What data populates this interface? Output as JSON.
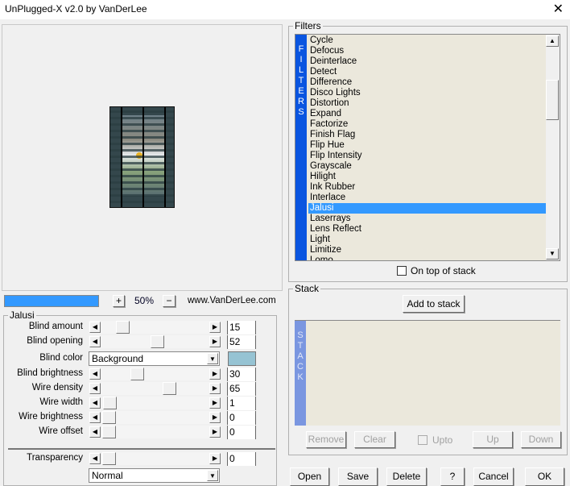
{
  "window": {
    "title": "UnPlugged-X v2.0 by VanDerLee",
    "close_icon": "close-icon"
  },
  "preview": {
    "zoom_progress_percent": 100,
    "zoom_in_label": "+",
    "zoom_level": "50%",
    "zoom_out_label": "−",
    "website": "www.VanDerLee.com"
  },
  "jalusi": {
    "title": "Jalusi",
    "sliders": [
      {
        "label": "Blind amount",
        "value": "15"
      },
      {
        "label": "Blind opening",
        "value": "52"
      }
    ],
    "blind_color": {
      "label": "Blind color",
      "selected": "Background",
      "swatch": "#96c3d3"
    },
    "sliders2": [
      {
        "label": "Blind brightness",
        "value": "30"
      },
      {
        "label": "Wire density",
        "value": "65"
      },
      {
        "label": "Wire width",
        "value": "1"
      },
      {
        "label": "Wire brightness",
        "value": "0"
      },
      {
        "label": "Wire offset",
        "value": "0"
      }
    ],
    "transparency": {
      "label": "Transparency",
      "value": "0"
    },
    "blend_mode": "Normal"
  },
  "filters": {
    "title": "Filters",
    "band": "FILTERS",
    "selected": "Jalusi",
    "items": [
      "Cycle",
      "Defocus",
      "Deinterlace",
      "Detect",
      "Difference",
      "Disco Lights",
      "Distortion",
      "Expand",
      "Factorize",
      "Finish Flag",
      "Flip Hue",
      "Flip Intensity",
      "Grayscale",
      "Hilight",
      "Ink Rubber",
      "Interlace",
      "Jalusi",
      "Laserrays",
      "Lens Reflect",
      "Light",
      "Limitize",
      "Lomo"
    ],
    "on_top_label": "On top of stack",
    "on_top_checked": false
  },
  "stack": {
    "title": "Stack",
    "band": "STACK",
    "add_label": "Add to stack",
    "remove_label": "Remove",
    "clear_label": "Clear",
    "upto_label": "Upto",
    "up_label": "Up",
    "down_label": "Down"
  },
  "footer": {
    "open": "Open",
    "save": "Save",
    "delete": "Delete",
    "help": "?",
    "cancel": "Cancel",
    "ok": "OK"
  },
  "colors": {
    "accent": "#3399ff",
    "band_filters": "#0a55e0",
    "band_stack": "#7a96e0",
    "list_bg": "#ebe8dc"
  }
}
